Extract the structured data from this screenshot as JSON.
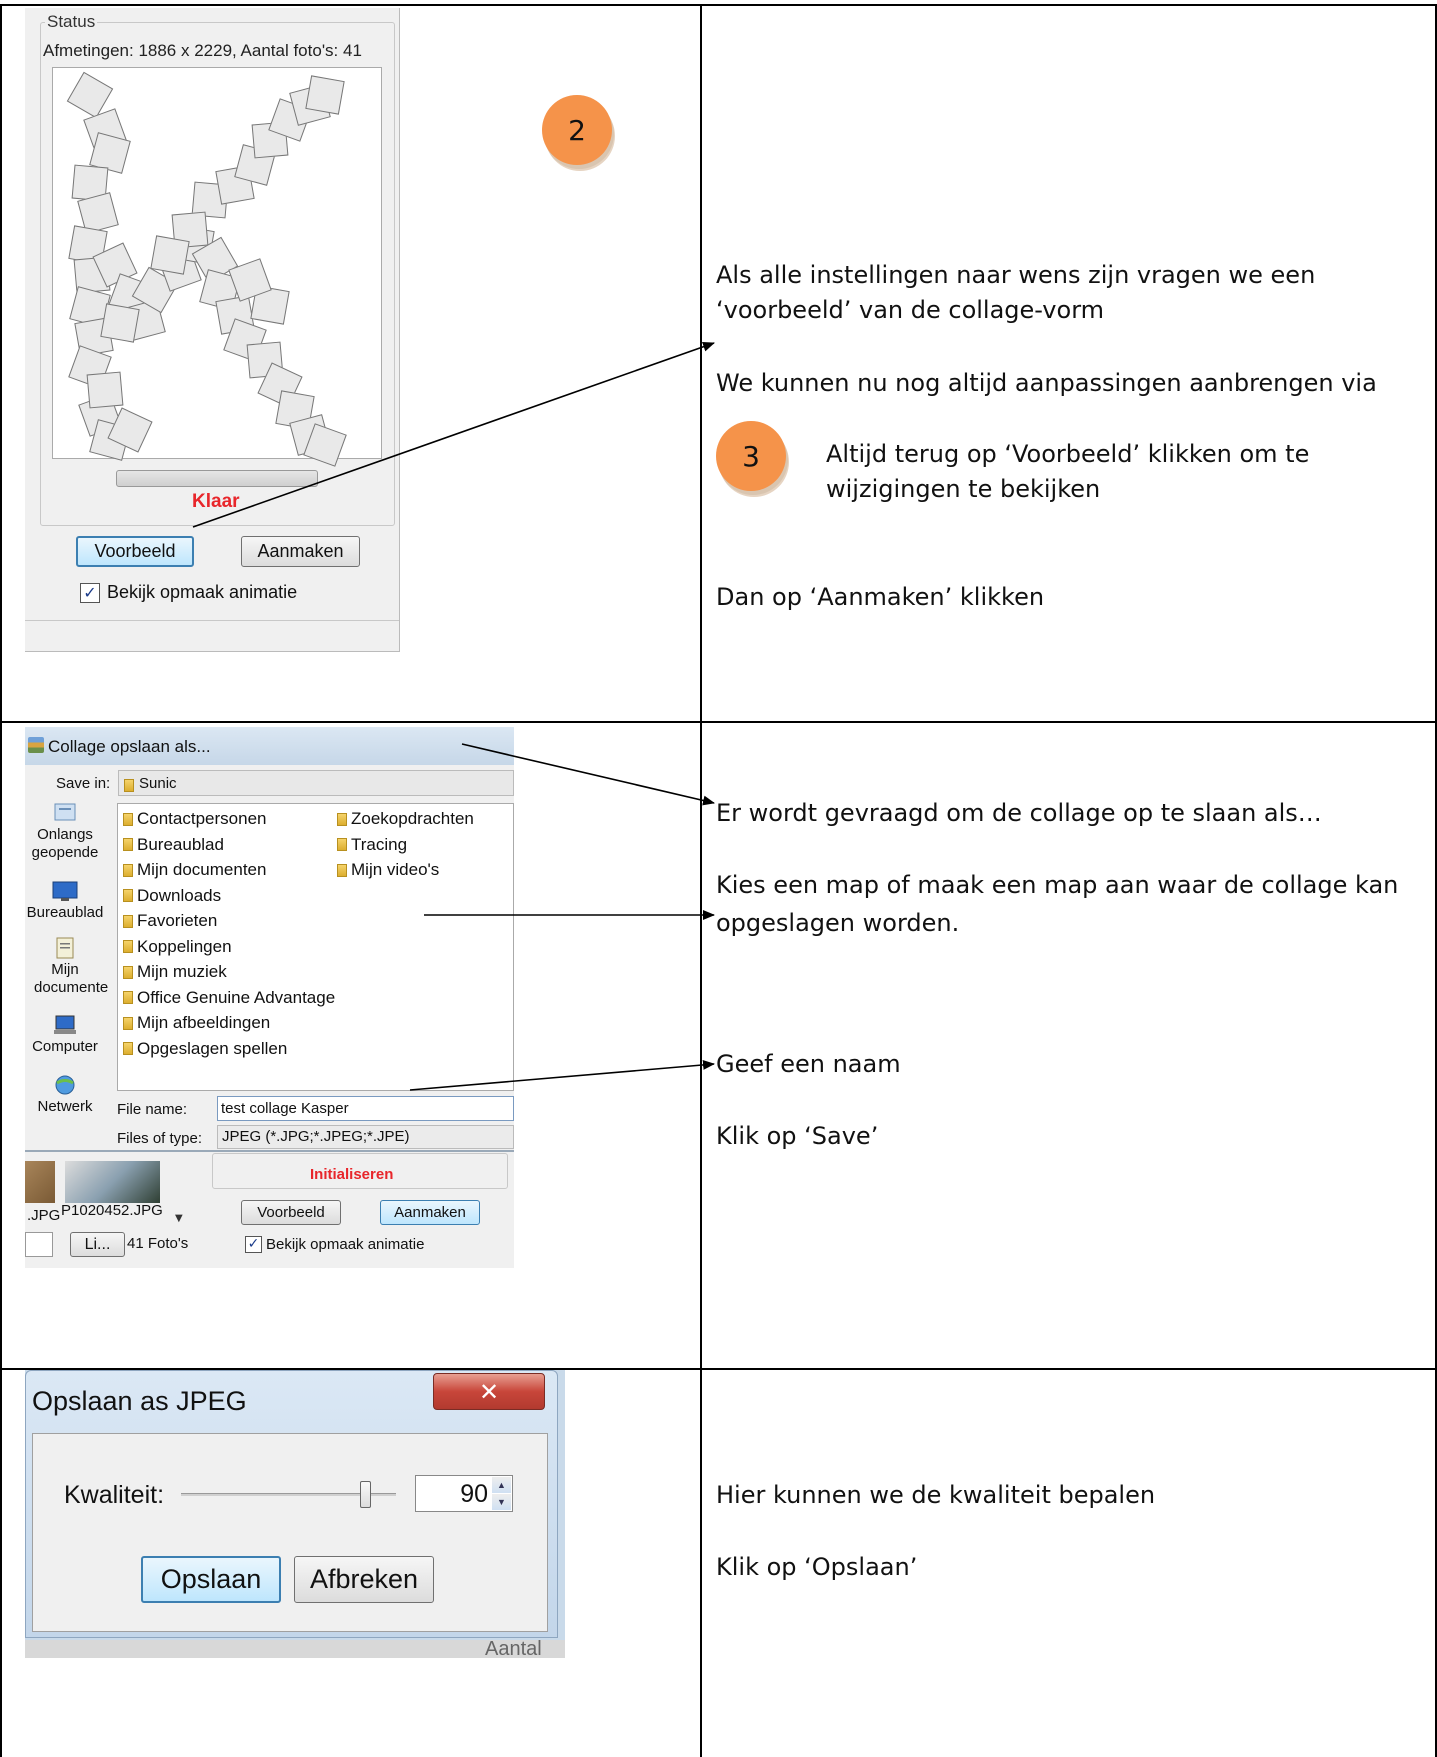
{
  "row1": {
    "status_panel": {
      "group_label": "Status",
      "dimensions_text": "Afmetingen: 1886 x 2229, Aantal foto's: 41",
      "state_text": "Klaar",
      "preview_button": "Voorbeeld",
      "create_button": "Aanmaken",
      "checkbox_label": "Bekijk opmaak animatie",
      "checkbox_checked": true
    },
    "badge_2": "2",
    "badge_3": "3",
    "text_lines": {
      "l1": "Als alle instellingen naar wens zijn vragen we een",
      "l2": "‘voorbeeld’ van de collage-vorm",
      "l3": "We kunnen nu nog altijd aanpassingen aanbrengen via",
      "l4": "Altijd terug op ‘Voorbeeld’ klikken om te",
      "l5": "wijzigingen te bekijken",
      "l6": "Dan op ‘Aanmaken’ klikken"
    }
  },
  "row2": {
    "dialog": {
      "title": "Collage opslaan als...",
      "save_in_label": "Save in:",
      "save_in_value": "Sunic",
      "places": [
        "Onlangs geopende items",
        "Bureaublad",
        "Mijn documente",
        "Computer",
        "Netwerk"
      ],
      "folders_col1": [
        "Contactpersonen",
        "Bureaublad",
        "Mijn documenten",
        "Downloads",
        "Favorieten",
        "Koppelingen",
        "Mijn muziek",
        "Office Genuine Advantage",
        "Mijn afbeeldingen",
        "Opgeslagen spellen"
      ],
      "folders_col2": [
        "Zoekopdrachten",
        "Tracing",
        "Mijn video's"
      ],
      "file_name_label": "File name:",
      "file_name_value": "test collage Kasper",
      "file_type_label": "Files of type:",
      "file_type_value": "JPEG (*.JPG;*.JPEG;*.JPE)"
    },
    "behind": {
      "status_text": "Initialiseren",
      "file_a": ".JPG",
      "file_b": "P1020452.JPG",
      "list_button": "Li...",
      "count_text": "41 Foto's",
      "preview_button": "Voorbeeld",
      "create_button": "Aanmaken",
      "checkbox_label": "Bekijk opmaak animatie"
    },
    "text_lines": {
      "l1": "Er wordt gevraagd om de collage op te slaan als…",
      "l2": "Kies een map of maak een map aan waar de collage kan",
      "l3": "opgeslagen worden.",
      "l4": "Geef een naam",
      "l5": "Klik op ‘Save’"
    }
  },
  "row3": {
    "dialog": {
      "title": "Opslaan as JPEG",
      "close_glyph": "✕",
      "quality_label": "Kwaliteit:",
      "quality_value": "90",
      "slider_fraction": 0.9,
      "save_button": "Opslaan",
      "cancel_button": "Afbreken",
      "behind_text": "Aantal"
    },
    "text_lines": {
      "l1": "Hier kunnen we de kwaliteit bepalen",
      "l2": "Klik op ‘Opslaan’"
    }
  },
  "colors": {
    "badge": "#f5934a",
    "status_red": "#e8262b",
    "border": "#000000"
  }
}
